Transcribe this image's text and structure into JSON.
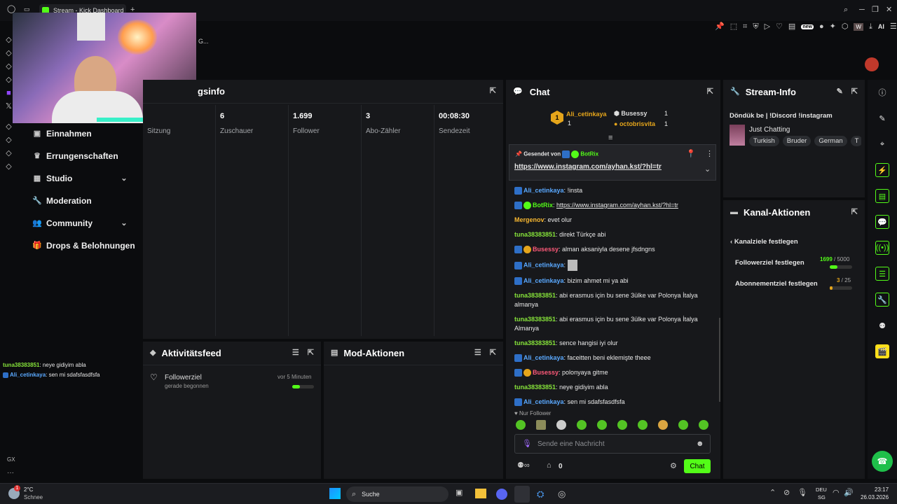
{
  "browser": {
    "tab_title": "Stream - Kick Dashboard",
    "new_tab": "+",
    "ext_badge_new": "new",
    "ext_w": "W",
    "ai_label": "AI",
    "header_truncated": "G..."
  },
  "nav": {
    "items": [
      {
        "label": "Einnahmen",
        "icon": "money-icon"
      },
      {
        "label": "Errungenschaften",
        "icon": "trophy-icon"
      },
      {
        "label": "Studio",
        "icon": "studio-icon",
        "expandable": true
      },
      {
        "label": "Moderation",
        "icon": "wrench-icon"
      },
      {
        "label": "Community",
        "icon": "people-icon",
        "expandable": true
      },
      {
        "label": "Drops & Belohnungen",
        "icon": "gift-icon"
      }
    ]
  },
  "session": {
    "title_partial": "gsinfo",
    "stats": [
      {
        "value": "",
        "label": "Sitzung"
      },
      {
        "value": "6",
        "label": "Zuschauer"
      },
      {
        "value": "1.699",
        "label": "Follower"
      },
      {
        "value": "3",
        "label": "Abo-Zähler"
      },
      {
        "value": "00:08:30",
        "label": "Sendezeit"
      }
    ]
  },
  "activity": {
    "title": "Aktivitätsfeed",
    "item_title": "Followerziel",
    "item_sub": "gerade begonnen",
    "item_time": "vor 5 Minuten",
    "progress": 0.34
  },
  "mod": {
    "title": "Mod-Aktionen"
  },
  "chat": {
    "title": "Chat",
    "top_gifters": [
      {
        "name": "Ali_cetinkaya",
        "count": "1",
        "rank": "1"
      },
      {
        "name": "Busessy",
        "count": "1"
      },
      {
        "name": "octobrisvita",
        "count": "1"
      }
    ],
    "pinned_label": "Gesendet von",
    "pinned_user": "BotRix",
    "pinned_link": "https://www.instagram.com/ayhan.kst/?hl=tr",
    "messages": [
      {
        "user": "Ali_cetinkaya",
        "color": "#5aa9ff",
        "badge": "mod",
        "text": "!insta"
      },
      {
        "user": "BotRix",
        "color": "#53fc18",
        "badge": "modverified",
        "text": "https://www.instagram.com/ayhan.kst/?hl=tr"
      },
      {
        "user": "Mergenov",
        "color": "#f7b731",
        "badge": "",
        "text": "evet olur"
      },
      {
        "user": "tuna38383851",
        "color": "#86e33a",
        "badge": "",
        "text": "direkt Türkçe abi"
      },
      {
        "user": "Busessy",
        "color": "#ff5a7a",
        "badge": "modgift",
        "text": "alman aksaniyla desene jfsdngns"
      },
      {
        "user": "Ali_cetinkaya",
        "color": "#5aa9ff",
        "badge": "mod",
        "text": ""
      },
      {
        "user": "Ali_cetinkaya",
        "color": "#5aa9ff",
        "badge": "mod",
        "text": "bizim ahmet mi ya abi"
      },
      {
        "user": "tuna38383851",
        "color": "#86e33a",
        "badge": "",
        "text": "abi erasmus için bu sene 3ülke var Polonya İtalya almanya"
      },
      {
        "user": "tuna38383851",
        "color": "#86e33a",
        "badge": "",
        "text": "abi erasmus için bu sene 3ülke var Polonya İtalya Almanya"
      },
      {
        "user": "tuna38383851",
        "color": "#86e33a",
        "badge": "",
        "text": "sence hangisi iyi olur"
      },
      {
        "user": "Ali_cetinkaya",
        "color": "#5aa9ff",
        "badge": "mod",
        "text": "faceitten beni eklemişte theee"
      },
      {
        "user": "Busessy",
        "color": "#ff5a7a",
        "badge": "modgift",
        "text": "polonyaya gitme"
      },
      {
        "user": "tuna38383851",
        "color": "#86e33a",
        "badge": "",
        "text": "neye gidiyim abla"
      },
      {
        "user": "Ali_cetinkaya",
        "color": "#5aa9ff",
        "badge": "mod",
        "text": "sen mi sdafsfasdfsfa"
      }
    ],
    "follower_only": "Nur Follower",
    "input_placeholder": "Sende eine Nachricht",
    "points": "0",
    "send_label": "Chat"
  },
  "overlay_chat": [
    {
      "user": "tuna38383851",
      "text": ": neye gidiyim abla"
    },
    {
      "user": "Ali_cetinkaya",
      "text": ": sen mi sdafsfasdfsfa"
    }
  ],
  "stream_info": {
    "title": "Stream-Info",
    "stream_title": "Döndük be | !Discord !instagram",
    "category": "Just Chatting",
    "tags": [
      "Turkish",
      "Bruder",
      "German",
      "T"
    ]
  },
  "channel_actions": {
    "title": "Kanal-Aktionen",
    "subtitle": "Kanalziele festlegen",
    "goals": [
      {
        "label": "Followerziel festlegen",
        "current": "1699",
        "target": " / 5000",
        "progress": 0.34
      },
      {
        "label": "Abonnementziel festlegen",
        "current": "3",
        "target": " / 25",
        "progress": 0.12
      }
    ]
  },
  "gx_label": "GX",
  "taskbar": {
    "weather_temp": "2°C",
    "weather_desc": "Schnee",
    "search": "Suche",
    "lang_top": "DEU",
    "lang_bottom": "SG",
    "time": "23:17",
    "date": "26.03.2026",
    "notif_badge": "1"
  },
  "colors": {
    "kick_green": "#53fc18",
    "panel": "#17181b",
    "bg": "#0b0c0e"
  }
}
